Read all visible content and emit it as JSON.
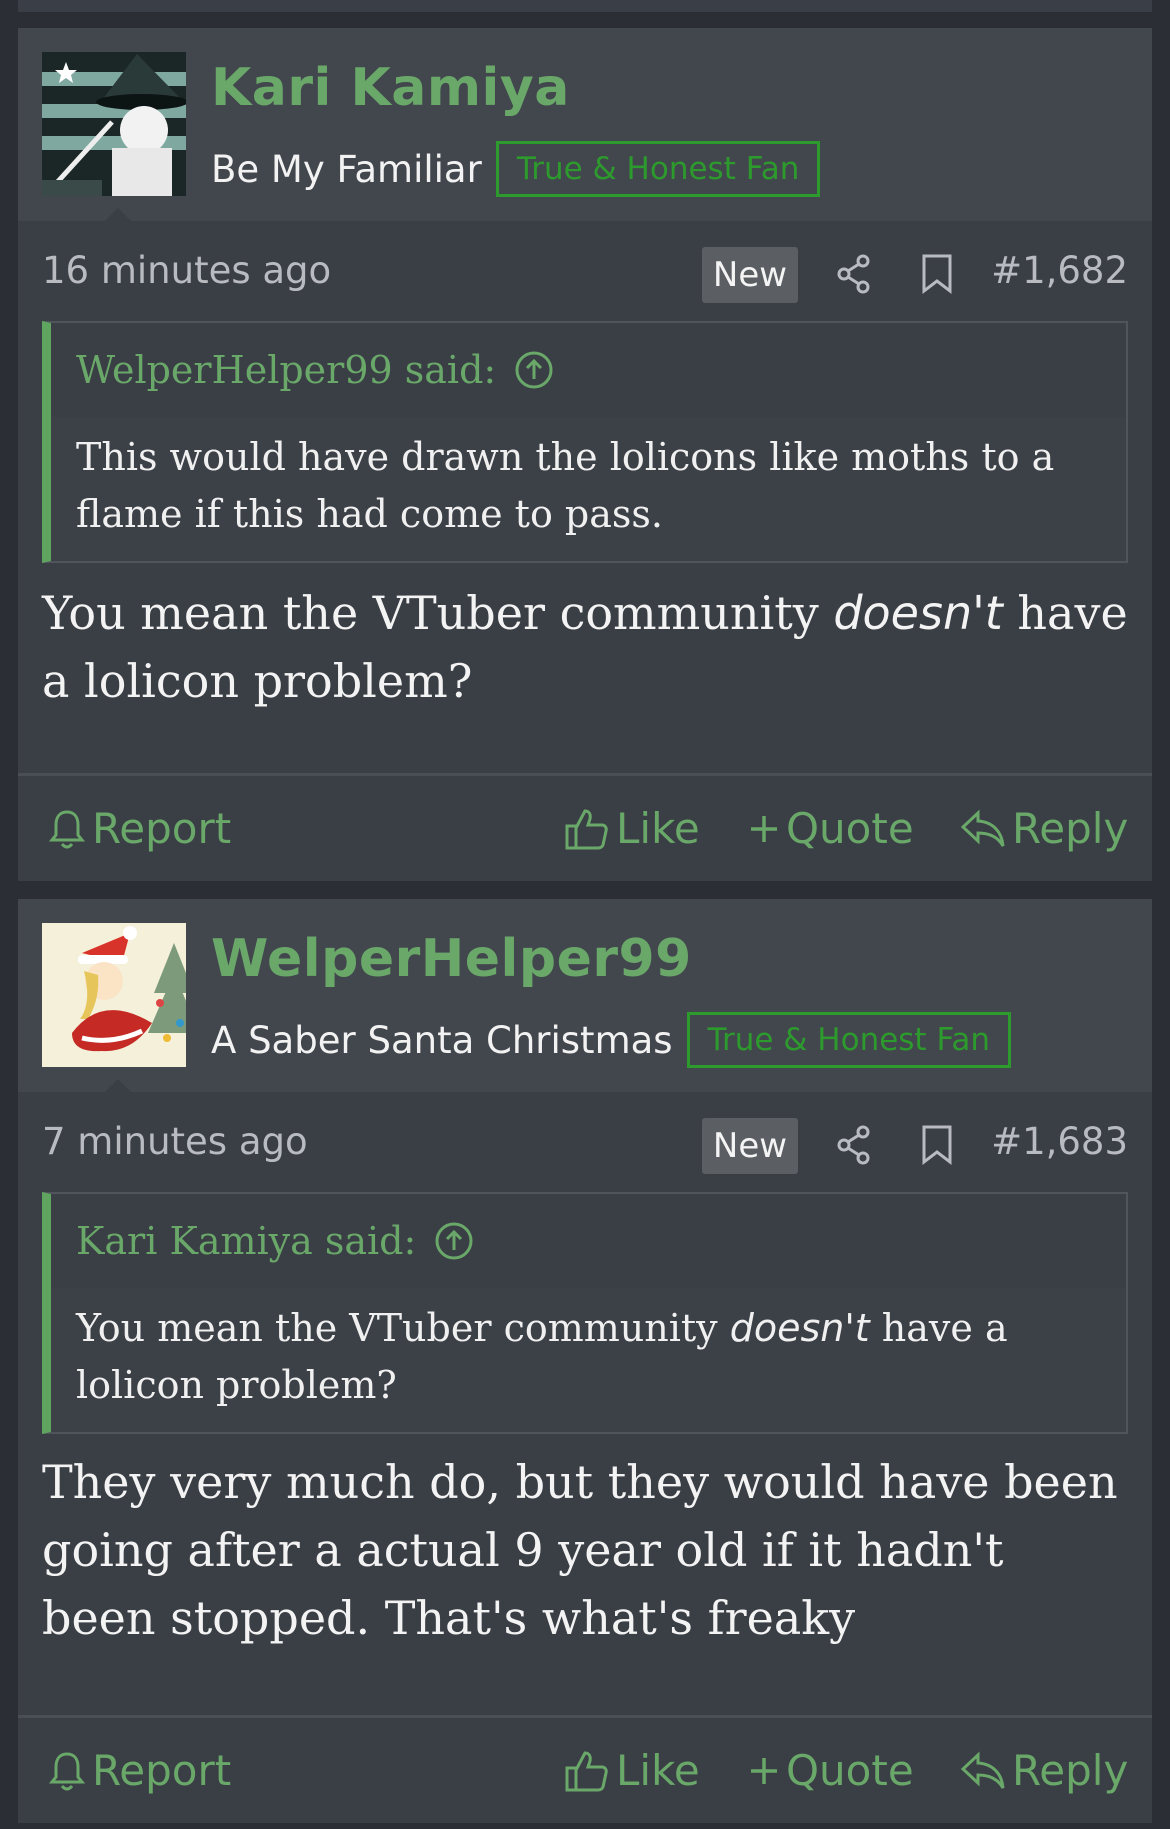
{
  "posts": [
    {
      "username": "Kari Kamiya",
      "user_title": "Be My Familiar",
      "badge": "True & Honest Fan",
      "timestamp": "16 minutes ago",
      "new_label": "New",
      "post_number": "#1,682",
      "quote": {
        "author_said": "WelperHelper99 said:",
        "text_line1": "This would have drawn the lolicons like moths to a",
        "text_line2": "flame if this had come to pass."
      },
      "body": {
        "pre": "You mean the VTuber community ",
        "emph": "doesn't",
        "post": " have a lolicon problem?"
      },
      "actions": {
        "report": "Report",
        "like": "Like",
        "quote": "Quote",
        "reply": "Reply"
      }
    },
    {
      "username": "WelperHelper99",
      "user_title": "A Saber Santa Christmas",
      "badge": "True & Honest Fan",
      "timestamp": "7 minutes ago",
      "new_label": "New",
      "post_number": "#1,683",
      "quote": {
        "author_said": "Kari Kamiya said:",
        "text_pre": "You mean the VTuber community ",
        "text_emph": "doesn't",
        "text_post": " have a lolicon problem?"
      },
      "body": {
        "text": "They very much do, but they would have been going after a actual 9 year old if it hadn't been stopped. That's what's freaky"
      },
      "actions": {
        "report": "Report",
        "like": "Like",
        "quote": "Quote",
        "reply": "Reply"
      }
    }
  ],
  "colors": {
    "accent_green": "#6aa86a",
    "badge_green": "#2d9a2d",
    "quote_bar": "#5fa55f",
    "background": "#2b2f35",
    "card": "#3a3e45"
  },
  "icons": [
    "bell-icon",
    "thumbs-up-icon",
    "plus-icon",
    "reply-arrow-icon",
    "share-icon",
    "bookmark-icon",
    "up-arrow-circle-icon"
  ]
}
